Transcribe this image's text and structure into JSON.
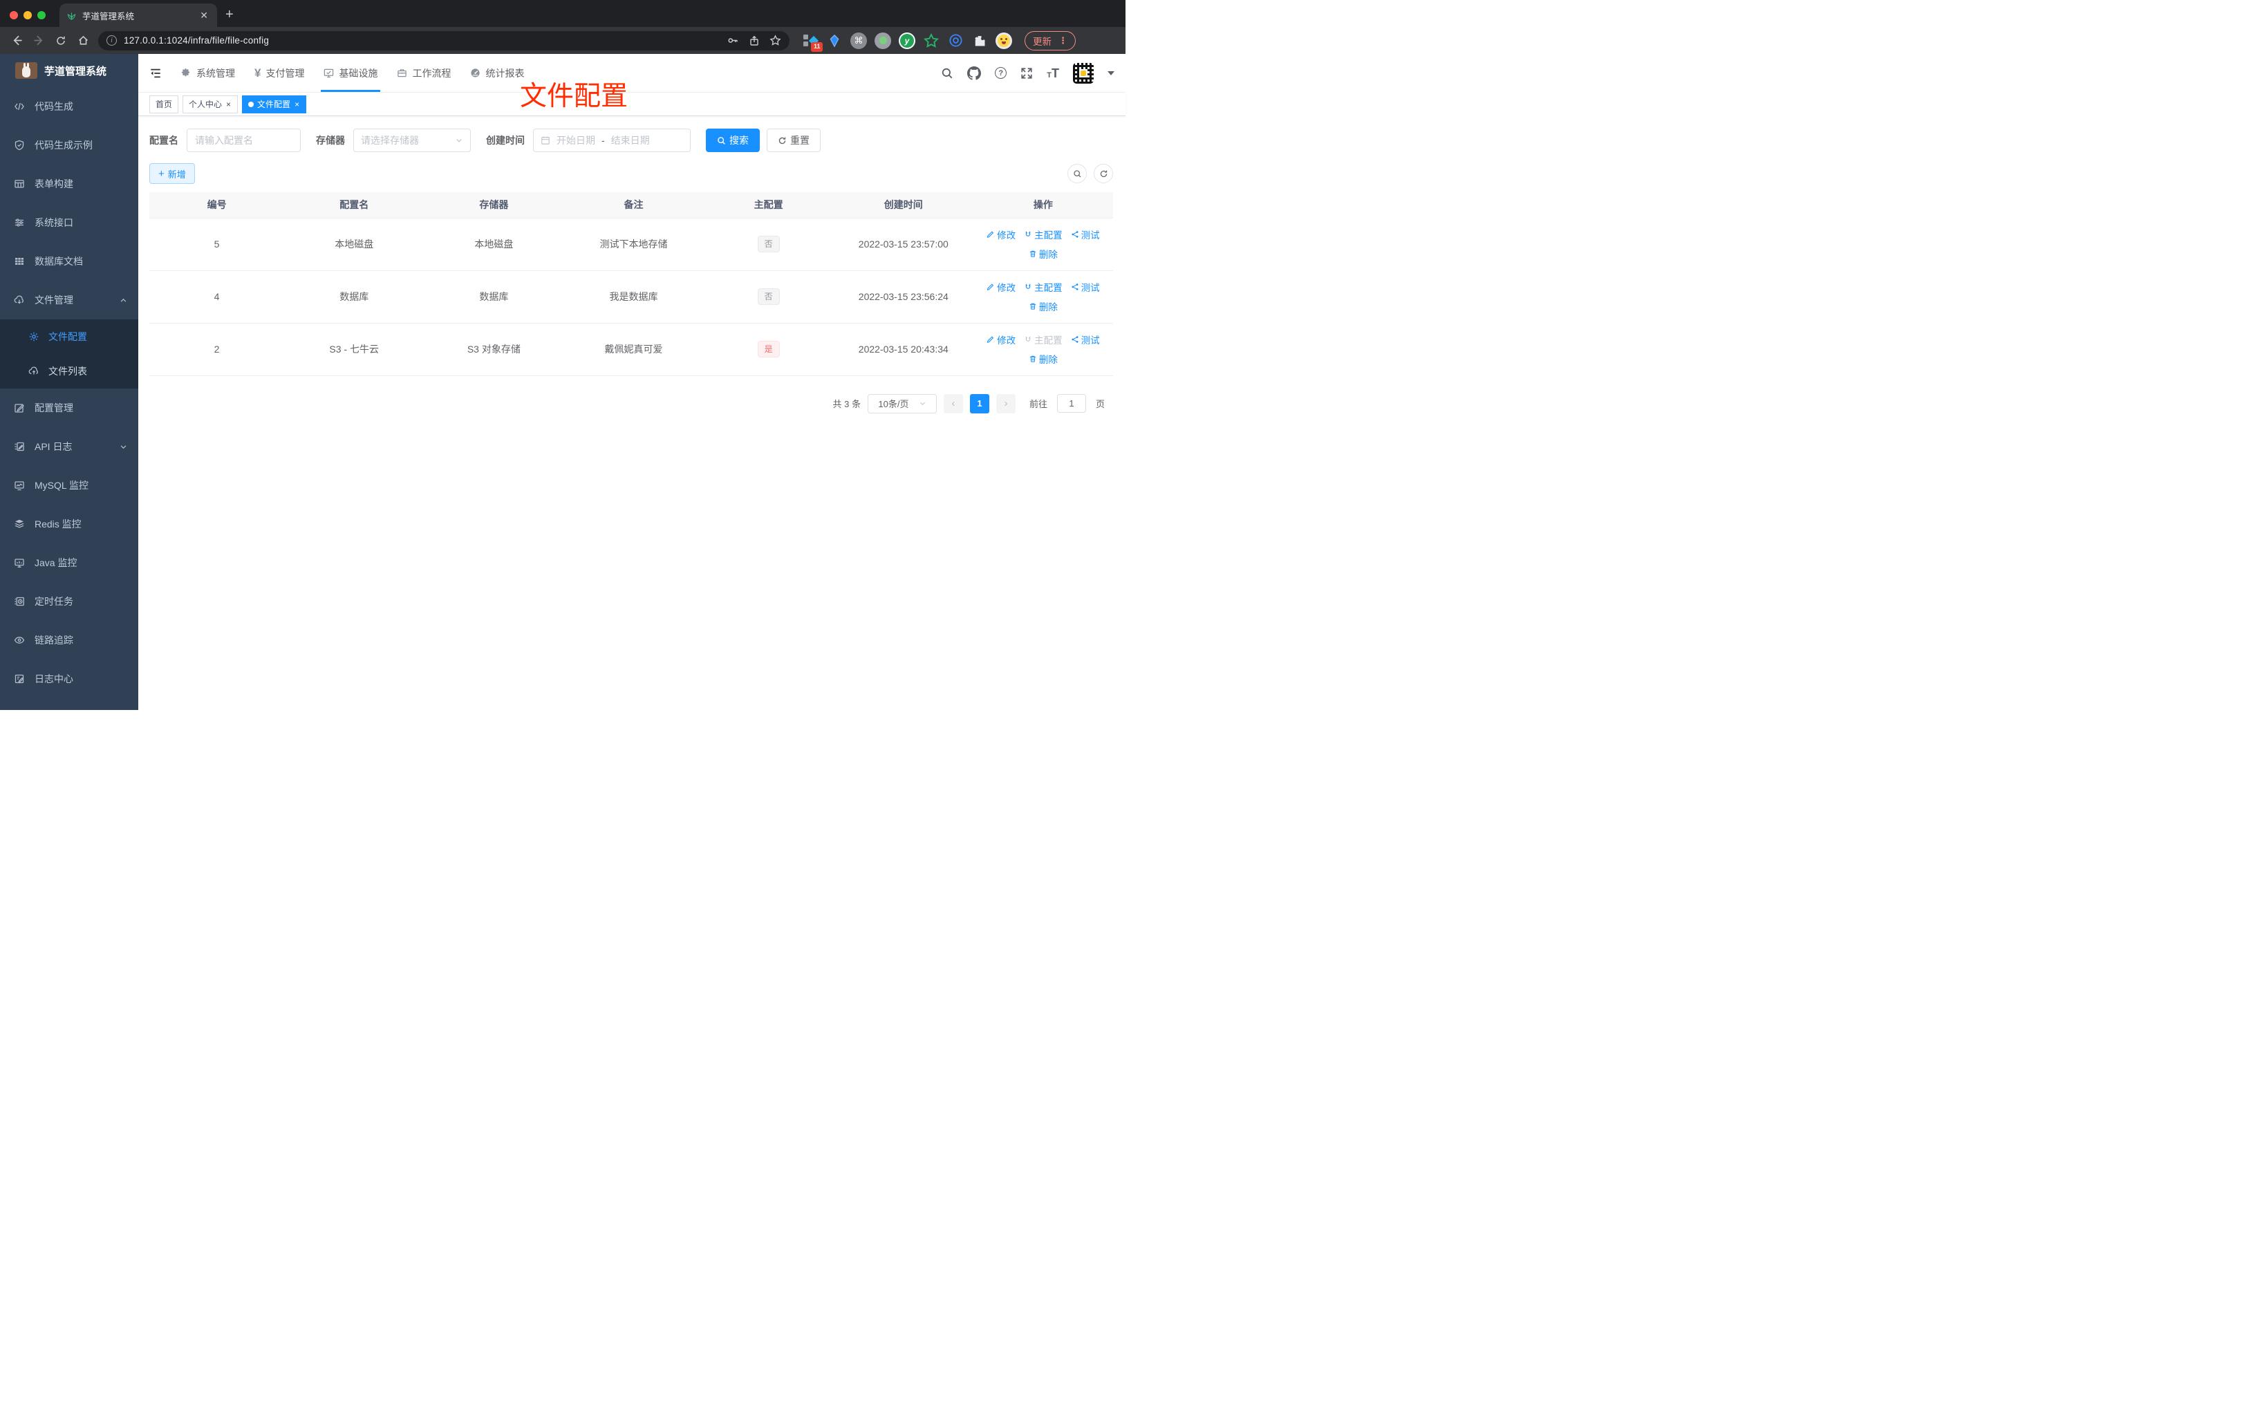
{
  "browser": {
    "tab_title": "芋道管理系统",
    "url": "127.0.0.1:1024/infra/file/file-config",
    "extension_badge": "11",
    "update_label": "更新"
  },
  "app": {
    "logo_title": "芋道管理系统",
    "annotation": "文件配置"
  },
  "topnav": {
    "items": [
      {
        "label": "系统管理",
        "icon": "gear-icon"
      },
      {
        "label": "支付管理",
        "icon": "yen-icon"
      },
      {
        "label": "基础设施",
        "icon": "monitor-check-icon",
        "active": true
      },
      {
        "label": "工作流程",
        "icon": "briefcase-icon"
      },
      {
        "label": "统计报表",
        "icon": "gauge-icon"
      }
    ]
  },
  "sidebar": {
    "items": [
      {
        "label": "代码生成",
        "icon": "code-icon"
      },
      {
        "label": "代码生成示例",
        "icon": "shield-check-icon"
      },
      {
        "label": "表单构建",
        "icon": "form-builder-icon"
      },
      {
        "label": "系统接口",
        "icon": "sliders-icon"
      },
      {
        "label": "数据库文档",
        "icon": "grid-icon"
      },
      {
        "label": "文件管理",
        "icon": "cloud-download-icon",
        "expanded": true
      },
      {
        "label": "文件配置",
        "icon": "gear-icon",
        "submenu": true,
        "active": true
      },
      {
        "label": "文件列表",
        "icon": "cloud-upload-icon",
        "submenu": true
      },
      {
        "label": "配置管理",
        "icon": "edit-icon"
      },
      {
        "label": "API 日志",
        "icon": "log-edit-icon",
        "collapsed": true
      },
      {
        "label": "MySQL 监控",
        "icon": "chart-monitor-icon"
      },
      {
        "label": "Redis 监控",
        "icon": "layers-icon"
      },
      {
        "label": "Java 监控",
        "icon": "monitor-icon"
      },
      {
        "label": "定时任务",
        "icon": "schedule-icon"
      },
      {
        "label": "链路追踪",
        "icon": "eye-icon"
      },
      {
        "label": "日志中心",
        "icon": "log-center-icon"
      }
    ]
  },
  "tabs": [
    {
      "label": "首页"
    },
    {
      "label": "个人中心",
      "closable": true
    },
    {
      "label": "文件配置",
      "closable": true,
      "active": true
    }
  ],
  "filters": {
    "name_label": "配置名",
    "name_placeholder": "请输入配置名",
    "storage_label": "存储器",
    "storage_placeholder": "请选择存储器",
    "time_label": "创建时间",
    "start_placeholder": "开始日期",
    "range_separator": "-",
    "end_placeholder": "结束日期",
    "search_label": "搜索",
    "reset_label": "重置"
  },
  "toolbar": {
    "add_label": "新增"
  },
  "table": {
    "headers": [
      "编号",
      "配置名",
      "存储器",
      "备注",
      "主配置",
      "创建时间",
      "操作"
    ],
    "actions": {
      "edit": "修改",
      "master": "主配置",
      "test": "测试",
      "delete": "删除"
    },
    "rows": [
      {
        "id": "5",
        "name": "本地磁盘",
        "storage": "本地磁盘",
        "remark": "测试下本地存储",
        "master": "否",
        "master_type": "info",
        "created": "2022-03-15 23:57:00"
      },
      {
        "id": "4",
        "name": "数据库",
        "storage": "数据库",
        "remark": "我是数据库",
        "master": "否",
        "master_type": "info",
        "created": "2022-03-15 23:56:24"
      },
      {
        "id": "2",
        "name": "S3 - 七牛云",
        "storage": "S3 对象存储",
        "remark": "戴佩妮真可爱",
        "master": "是",
        "master_type": "danger",
        "created": "2022-03-15 20:43:34",
        "master_action_disabled": true
      }
    ]
  },
  "pagination": {
    "total": "共 3 条",
    "page_size": "10条/页",
    "page": "1",
    "goto_label": "前往",
    "goto_value": "1",
    "page_suffix": "页"
  },
  "colors": {
    "theme_blue": "#1890ff",
    "sidebar_bg": "#304156",
    "submenu_bg": "#1f2d3d",
    "annotation_red": "#ff2d00",
    "tag_danger_text": "#f56c6c"
  }
}
